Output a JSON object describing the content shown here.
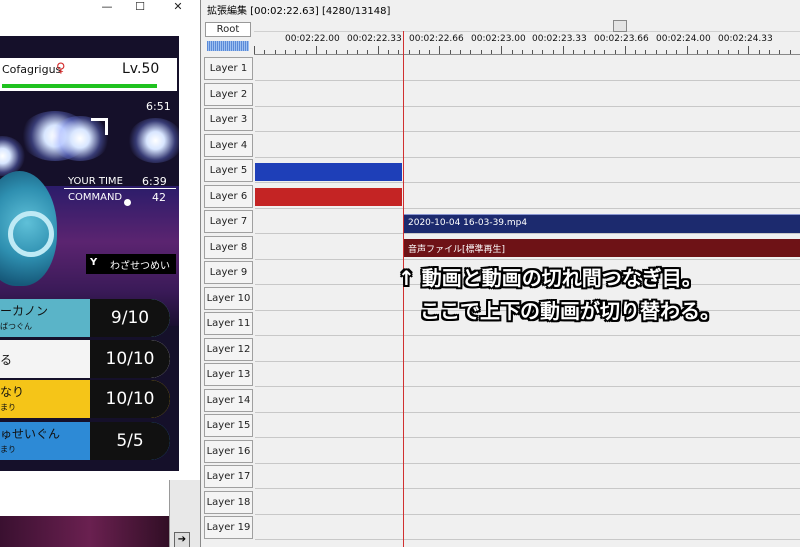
{
  "window_controls": {
    "minimize": "—",
    "maximize": "☐",
    "close": "✕"
  },
  "game": {
    "pokemon_name": "Cofagrigus",
    "gender_symbol": "♀",
    "level": "Lv.50",
    "timer": "6:51",
    "your_time_label": "YOUR TIME",
    "your_time_value": "6:39",
    "command_label": "COMMAND",
    "command_value": "42",
    "y_key": "Y",
    "y_hint": "わざせつめい",
    "moves": [
      {
        "name": "ーカノン",
        "sub": "ばつぐん",
        "pp": "9/10",
        "color": "#5ab4c8"
      },
      {
        "name": "る",
        "sub": "",
        "pp": "10/10",
        "color": "#f4f4f4"
      },
      {
        "name": "なり",
        "sub": "まり",
        "pp": "10/10",
        "color": "#f5c518"
      },
      {
        "name": "ゅせいぐん",
        "sub": "まり",
        "pp": "5/5",
        "color": "#2d8ad6"
      }
    ]
  },
  "editor": {
    "title": "拡張編集 [00:02:22.63] [4280/13148]",
    "root_label": "Root",
    "ruler": [
      "00:02:22.00",
      "00:02:22.33",
      "00:02:22.66",
      "00:02:23.00",
      "00:02:23.33",
      "00:02:23.66",
      "00:02:24.00",
      "00:02:24.33"
    ],
    "layers": [
      "Layer 1",
      "Layer 2",
      "Layer 3",
      "Layer 4",
      "Layer 5",
      "Layer 6",
      "Layer 7",
      "Layer 8",
      "Layer 9",
      "Layer 10",
      "Layer 11",
      "Layer 12",
      "Layer 13",
      "Layer 14",
      "Layer 15",
      "Layer 16",
      "Layer 17",
      "Layer 18",
      "Layer 19"
    ],
    "clips": {
      "video_clip_label": "2020-10-04 16-03-39.mp4",
      "audio_clip_label": "音声ファイル[標準再生]",
      "colors": {
        "blue": "#1e3fb8",
        "red": "#c42424",
        "navy": "#1c2a6e",
        "maroon": "#6e1216"
      }
    }
  },
  "annotation": {
    "line1": "↑ 動画と動画の切れ間つなぎ目。",
    "line2": "ここで上下の動画が切り替わる。"
  }
}
